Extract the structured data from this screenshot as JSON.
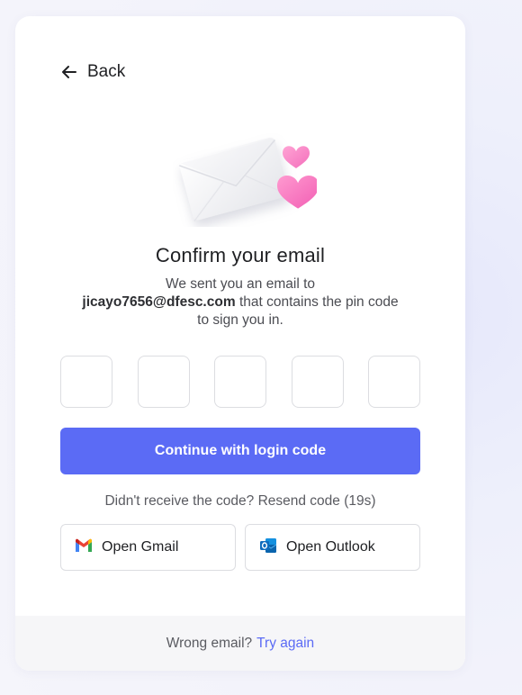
{
  "back": {
    "label": "Back",
    "icon": "arrow-left-icon"
  },
  "heading": {
    "title": "Confirm your email"
  },
  "subtitle": {
    "prefix": "We sent you an email to",
    "email": "jicayo7656@dfesc.com",
    "suffix": "that contains the pin code to sign you in."
  },
  "pin": {
    "length": 5,
    "values": [
      "",
      "",
      "",
      "",
      ""
    ]
  },
  "continue_button": {
    "label": "Continue with login code"
  },
  "resend": {
    "text": "Didn't receive the code? Resend code (19s)"
  },
  "open_buttons": {
    "gmail": {
      "label": "Open Gmail",
      "icon": "gmail-icon"
    },
    "outlook": {
      "label": "Open Outlook",
      "icon": "outlook-icon"
    }
  },
  "footer": {
    "text": "Wrong email?",
    "link": "Try again"
  },
  "colors": {
    "accent": "#5b6bf5",
    "card": "#ffffff",
    "footer_bg": "#f6f6f8"
  }
}
